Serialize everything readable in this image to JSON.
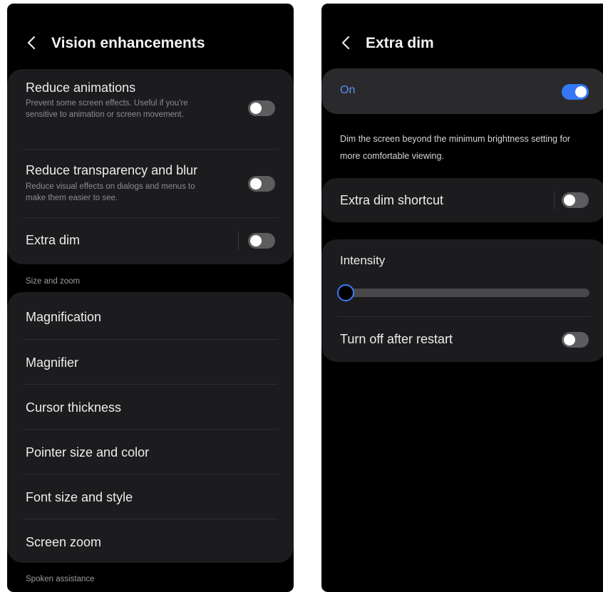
{
  "left_screen": {
    "header": {
      "title": "Vision enhancements",
      "back_icon": "chevron-left-icon"
    },
    "card1": {
      "reduce_animations": {
        "title": "Reduce animations",
        "description": "Prevent some screen effects. Useful if you're sensitive to animation or screen movement.",
        "enabled": false
      },
      "reduce_transparency": {
        "title": "Reduce transparency and blur",
        "description": "Reduce visual effects on dialogs and menus to make them easier to see.",
        "enabled": false
      },
      "extra_dim": {
        "title": "Extra dim",
        "enabled": false
      }
    },
    "size_zoom_section": "Size and zoom",
    "size_zoom_items": [
      "Magnification",
      "Magnifier",
      "Cursor thickness",
      "Pointer size and color",
      "Font size and style",
      "Screen zoom"
    ],
    "spoken_section": "Spoken assistance"
  },
  "right_screen": {
    "header": {
      "title": "Extra dim",
      "back_icon": "chevron-left-icon"
    },
    "main_switch": {
      "label": "On",
      "enabled": true
    },
    "helper_text": "Dim the screen beyond the minimum brightness setting for more comfortable viewing.",
    "shortcut": {
      "label": "Extra dim shortcut",
      "enabled": false
    },
    "intensity": {
      "label": "Intensity",
      "value": 0
    },
    "turn_off_after_restart": {
      "label": "Turn off after restart",
      "enabled": false
    }
  },
  "colors": {
    "accent": "#3478f6",
    "accent_text": "#5b8ef5",
    "card": "#1c1c1e",
    "background": "#000000",
    "toggle_off": "#5d5d60"
  }
}
